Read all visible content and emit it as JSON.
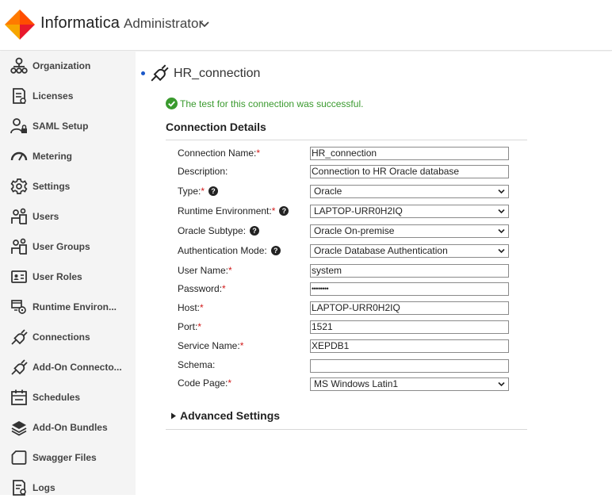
{
  "header": {
    "brand": "Informatica",
    "module": "Administrator",
    "accent_colors": [
      "#ff4d00",
      "#f7a600",
      "#e8182b"
    ]
  },
  "sidebar": {
    "items": [
      {
        "label": "Organization",
        "icon": "organization-icon"
      },
      {
        "label": "Licenses",
        "icon": "license-icon"
      },
      {
        "label": "SAML Setup",
        "icon": "saml-icon"
      },
      {
        "label": "Metering",
        "icon": "metering-icon"
      },
      {
        "label": "Settings",
        "icon": "settings-icon"
      },
      {
        "label": "Users",
        "icon": "users-icon"
      },
      {
        "label": "User Groups",
        "icon": "user-groups-icon"
      },
      {
        "label": "User Roles",
        "icon": "user-roles-icon"
      },
      {
        "label": "Runtime Environ...",
        "icon": "runtime-icon"
      },
      {
        "label": "Connections",
        "icon": "connections-icon"
      },
      {
        "label": "Add-On Connecto...",
        "icon": "addon-connector-icon"
      },
      {
        "label": "Schedules",
        "icon": "schedules-icon"
      },
      {
        "label": "Add-On Bundles",
        "icon": "bundles-icon"
      },
      {
        "label": "Swagger Files",
        "icon": "swagger-icon"
      },
      {
        "label": "Logs",
        "icon": "logs-icon"
      }
    ]
  },
  "main": {
    "title": "HR_connection",
    "success_message": "The test for this connection was successful.",
    "section_title": "Connection Details",
    "advanced_label": "Advanced Settings",
    "fields": [
      {
        "label": "Connection Name:",
        "required": "*",
        "help": "",
        "value": "HR_connection",
        "kind": "text"
      },
      {
        "label": "Description:",
        "required": "",
        "help": "",
        "value": "Connection to HR Oracle database",
        "kind": "text"
      },
      {
        "label": "Type:",
        "required": "*",
        "help": "?",
        "value": "Oracle",
        "kind": "select"
      },
      {
        "label": "Runtime Environment:",
        "required": "*",
        "help": "?",
        "value": "LAPTOP-URR0H2IQ",
        "kind": "select"
      },
      {
        "label": "Oracle Subtype:",
        "required": "",
        "help": "?",
        "value": "Oracle On-premise",
        "kind": "select"
      },
      {
        "label": "Authentication Mode:",
        "required": "",
        "help": "?",
        "value": "Oracle Database Authentication",
        "kind": "select"
      },
      {
        "label": "User Name:",
        "required": "*",
        "help": "",
        "value": "system",
        "kind": "text"
      },
      {
        "label": "Password:",
        "required": "*",
        "help": "",
        "value": "••••••••",
        "kind": "password"
      },
      {
        "label": "Host:",
        "required": "*",
        "help": "",
        "value": "LAPTOP-URR0H2IQ",
        "kind": "text"
      },
      {
        "label": "Port:",
        "required": "*",
        "help": "",
        "value": "1521",
        "kind": "text"
      },
      {
        "label": "Service Name:",
        "required": "*",
        "help": "",
        "value": "XEPDB1",
        "kind": "text"
      },
      {
        "label": "Schema:",
        "required": "",
        "help": "",
        "value": "",
        "kind": "text"
      },
      {
        "label": "Code Page:",
        "required": "*",
        "help": "",
        "value": "MS Windows Latin1",
        "kind": "select"
      }
    ]
  }
}
